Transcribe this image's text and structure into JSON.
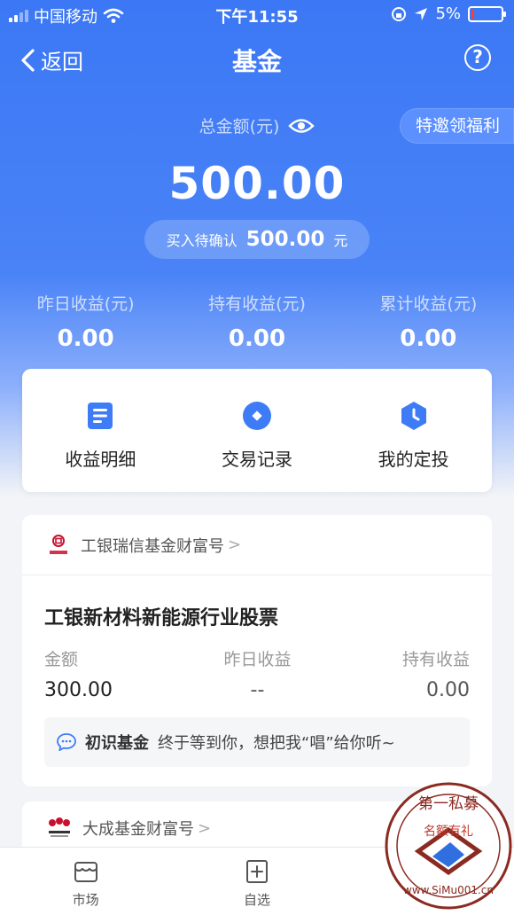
{
  "status_bar": {
    "carrier": "中国移动",
    "time": "下午11:55",
    "battery": "5%"
  },
  "nav": {
    "back_label": "返回",
    "title": "基金",
    "help": "?"
  },
  "summary": {
    "total_label": "总金额(元)",
    "invite_button": "特邀领福利",
    "total_amount": "500.00",
    "pending_label": "买入待确认",
    "pending_amount": "500.00",
    "pending_unit": "元"
  },
  "stats": [
    {
      "label": "昨日收益(元)",
      "value": "0.00"
    },
    {
      "label": "持有收益(元)",
      "value": "0.00"
    },
    {
      "label": "累计收益(元)",
      "value": "0.00"
    }
  ],
  "quick_actions": [
    {
      "label": "收益明细",
      "icon": "document-icon"
    },
    {
      "label": "交易记录",
      "icon": "record-icon"
    },
    {
      "label": "我的定投",
      "icon": "clock-icon"
    }
  ],
  "fund_card": {
    "company": "工银瑞信基金财富号",
    "logo_text": "工银瑞信",
    "fund_name": "工银新材料新能源行业股票",
    "col_amount_label": "金额",
    "col_amount_value": "300.00",
    "col_yesterday_label": "昨日收益",
    "col_yesterday_value": "--",
    "col_holding_label": "持有收益",
    "col_holding_value": "0.00",
    "tip_title": "初识基金",
    "tip_text": "终于等到你，想把我“唱”给你听~"
  },
  "fund_card_2": {
    "company": "大成基金财富号",
    "logo_text": "大成基金"
  },
  "tabbar": [
    {
      "label": "市场",
      "icon": "market-icon"
    },
    {
      "label": "自选",
      "icon": "add-favorite-icon"
    }
  ],
  "watermark": {
    "top_text": "第一私募",
    "middle_text": "名额有礼",
    "bottom_text": "www.SiMu001.cn"
  },
  "colors": {
    "primary_blue": "#3c78f5",
    "icon_blue": "#3d7cf6"
  }
}
